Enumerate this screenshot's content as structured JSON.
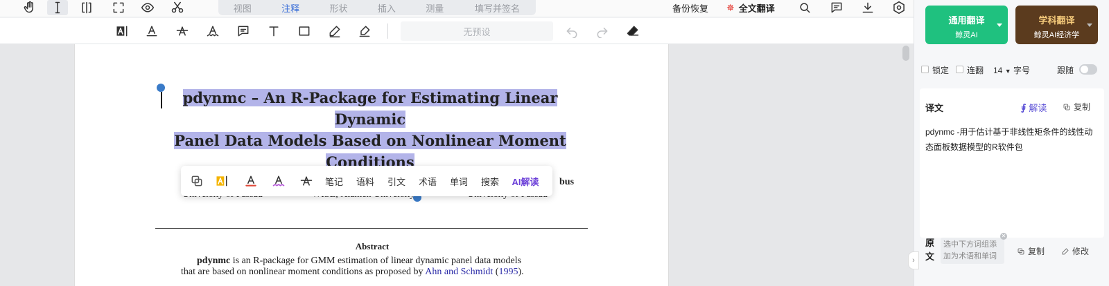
{
  "top_tabs": [
    {
      "label": "视图",
      "active": false
    },
    {
      "label": "注释",
      "active": true
    },
    {
      "label": "形状",
      "active": false
    },
    {
      "label": "插入",
      "active": false
    },
    {
      "label": "测量",
      "active": false
    },
    {
      "label": "填写并签名",
      "active": false
    }
  ],
  "top_right": {
    "backup": "备份恢复",
    "full_translate": "全文翻译"
  },
  "toolbar2": {
    "preset": "无预设"
  },
  "document": {
    "title_lines": [
      "pdynmc – An R-Package for Estimating Linear Dynamic",
      "Panel Data Models Based on Nonlinear Moment",
      "Conditions"
    ],
    "author_tail": "bus",
    "affiliations": [
      "University of Passau",
      "WISE, Xiamen University",
      "University of Passau"
    ],
    "abstract_heading": "Abstract",
    "abstract_line1_bold": "pdynmc",
    "abstract_line1_rest": " is an R-package for GMM estimation of linear dynamic panel data models",
    "abstract_line2_pre": "that are based on nonlinear moment conditions as proposed by ",
    "abstract_line2_cite": "Ahn and Schmidt",
    "abstract_line2_open": " (",
    "abstract_line2_year": "1995",
    "abstract_line2_close": ")."
  },
  "float_toolbar": {
    "note": "笔记",
    "corpus": "语料",
    "cite": "引文",
    "term": "术语",
    "word": "单词",
    "search": "搜索",
    "ai_read": "AI解读"
  },
  "panel": {
    "general_translate": {
      "title": "通用翻译",
      "engine": "鲸灵AI"
    },
    "subject_translate": {
      "title": "学科翻译",
      "engine": "鲸灵AI经济学"
    },
    "options": {
      "lock": "锁定",
      "continuous": "连翻",
      "font_size": "14",
      "font_size_label": "字号",
      "follow": "跟随"
    },
    "translation_heading": "译文",
    "interpret": "解读",
    "copy": "复制",
    "translation_text": "pdynmc -用于估计基于非线性矩条件的线性动态面板数据模型的R软件包",
    "original_heading_1": "原",
    "original_heading_2": "文",
    "hint_line1": "选中下方词组添",
    "hint_line2": "加为术语和单词",
    "copy2": "复制",
    "edit": "修改"
  },
  "colors": {
    "highlight": "#b3b4e9",
    "general_btn": "#1fc17f",
    "subject_btn": "#5b3b1e",
    "subject_text": "#f4c97a",
    "accent_blue": "#3b6fd8",
    "ai_purple": "#6b3fd8"
  }
}
